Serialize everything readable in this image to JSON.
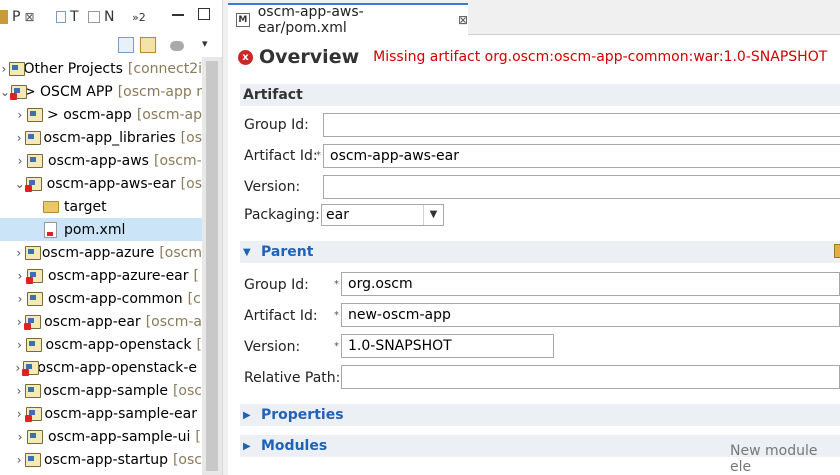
{
  "left_tabs": [
    {
      "label": "P",
      "close": "⊠"
    },
    {
      "label": "T"
    },
    {
      "label": "N"
    },
    {
      "label": "»2"
    }
  ],
  "tree": [
    {
      "name": "Other Projects",
      "dec": "[connect2i",
      "chev": "›",
      "icon": "proj"
    },
    {
      "name": "> OSCM APP",
      "dec": "[oscm-app r",
      "chev": "⌄",
      "icon": "proj-err"
    },
    {
      "name": "> oscm-app",
      "dec": "[oscm-ap",
      "chev": "›",
      "icon": "proj"
    },
    {
      "name": "oscm-app_libraries",
      "dec": "[os",
      "chev": "›",
      "icon": "proj"
    },
    {
      "name": "oscm-app-aws",
      "dec": "[oscm-",
      "chev": "›",
      "icon": "proj"
    },
    {
      "name": "oscm-app-aws-ear",
      "dec": "[os",
      "chev": "⌄",
      "icon": "proj-err"
    },
    {
      "name": "target",
      "dec": "",
      "chev": "",
      "icon": "folder"
    },
    {
      "name": "pom.xml",
      "dec": "",
      "chev": "",
      "icon": "xml"
    },
    {
      "name": "oscm-app-azure",
      "dec": "[oscm",
      "chev": "›",
      "icon": "proj"
    },
    {
      "name": "oscm-app-azure-ear",
      "dec": "[",
      "chev": "›",
      "icon": "proj-err"
    },
    {
      "name": "oscm-app-common",
      "dec": "[c",
      "chev": "›",
      "icon": "proj"
    },
    {
      "name": "oscm-app-ear",
      "dec": "[oscm-a",
      "chev": "›",
      "icon": "proj-err"
    },
    {
      "name": "oscm-app-openstack",
      "dec": "[",
      "chev": "›",
      "icon": "proj"
    },
    {
      "name": "oscm-app-openstack-e",
      "dec": "",
      "chev": "›",
      "icon": "proj-err"
    },
    {
      "name": "oscm-app-sample",
      "dec": "[osc",
      "chev": "›",
      "icon": "proj"
    },
    {
      "name": "oscm-app-sample-ear",
      "dec": "",
      "chev": "›",
      "icon": "proj-err"
    },
    {
      "name": "oscm-app-sample-ui",
      "dec": "[",
      "chev": "›",
      "icon": "proj"
    },
    {
      "name": "oscm-app-startup",
      "dec": "[osc",
      "chev": "›",
      "icon": "proj"
    }
  ],
  "editor": {
    "tab_title": "oscm-app-aws-ear/pom.xml",
    "tab_icon_letter": "M",
    "tab_close": "⊠",
    "overview_title": "Overview",
    "error_message": "Missing artifact org.oscm:oscm-app-common:war:1.0-SNAPSHOT",
    "artifact": {
      "header": "Artifact",
      "group_id_label": "Group Id:",
      "group_id": "",
      "artifact_id_label": "Artifact Id:",
      "artifact_id": "oscm-app-aws-ear",
      "version_label": "Version:",
      "version": "",
      "packaging_label": "Packaging:",
      "packaging": "ear"
    },
    "parent": {
      "header": "Parent",
      "group_id_label": "Group Id:",
      "group_id": "org.oscm",
      "artifact_id_label": "Artifact Id:",
      "artifact_id": "new-oscm-app",
      "version_label": "Version:",
      "version": "1.0-SNAPSHOT",
      "relative_path_label": "Relative Path:",
      "relative_path": ""
    },
    "properties_header": "Properties",
    "modules_header": "Modules",
    "new_module_text": "New module ele"
  },
  "colors": {
    "section_link": "#1f62b8",
    "error": "#d20000",
    "selection": "#cce4f7"
  }
}
